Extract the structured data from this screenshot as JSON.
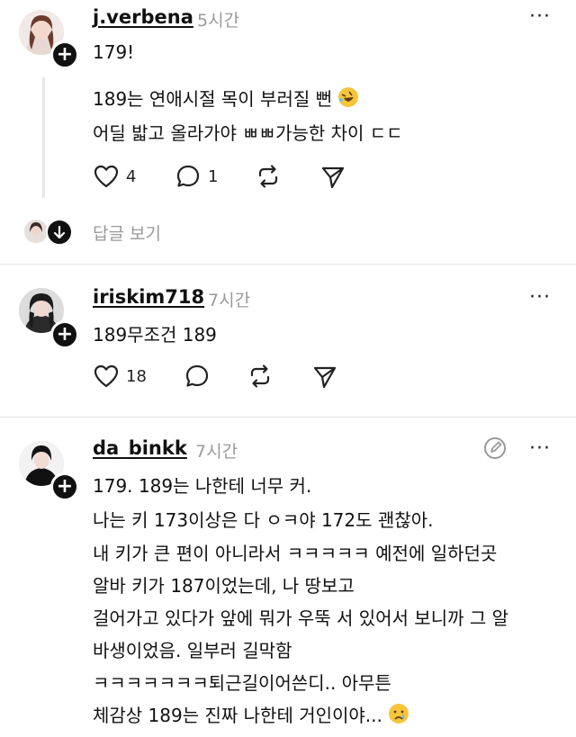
{
  "posts": [
    {
      "username": "j.verbena",
      "time": "5시간",
      "more": "···",
      "lines": [
        "179!"
      ],
      "reply": {
        "lines": [
          "189는 연애시절 목이 부러질 뻔",
          "어딜 밟고 올라가야 ㅃㅃ가능한 차이 ㄷㄷ"
        ],
        "emoji": "rofl-emoji"
      },
      "likes": "4",
      "comments": "1",
      "view_replies": "답글 보기"
    },
    {
      "username": "iriskim718",
      "time": "7시간",
      "more": "···",
      "lines": [
        "189무조건 189"
      ],
      "likes": "18"
    },
    {
      "username": "da_binkk",
      "time": "7시간",
      "more": "···",
      "lines": [
        "179. 189는 나한테 너무 커.",
        "나는 키 173이상은 다 ㅇㅋ야 172도 괜찮아.",
        "내 키가 큰 편이 아니라서 ㅋㅋㅋㅋㅋ 예전에 일하던곳",
        "알바 키가 187이었는데, 나 땅보고",
        "걸어가고 있다가 앞에 뭐가 우뚝 서 있어서 보니까 그 알",
        "바생이었음. 일부러 길막함",
        "ㅋㅋㅋㅋㅋㅋㅋ퇴근길이어쓴디.. 아무튼",
        "체감상 189는 진짜 나한테 거인이야..."
      ],
      "last_emoji": "crying-face-emoji"
    }
  ],
  "icons": [
    "heart-icon",
    "comment-icon",
    "repost-icon",
    "send-icon",
    "plus-icon",
    "edit-icon",
    "arrow-down-icon"
  ]
}
